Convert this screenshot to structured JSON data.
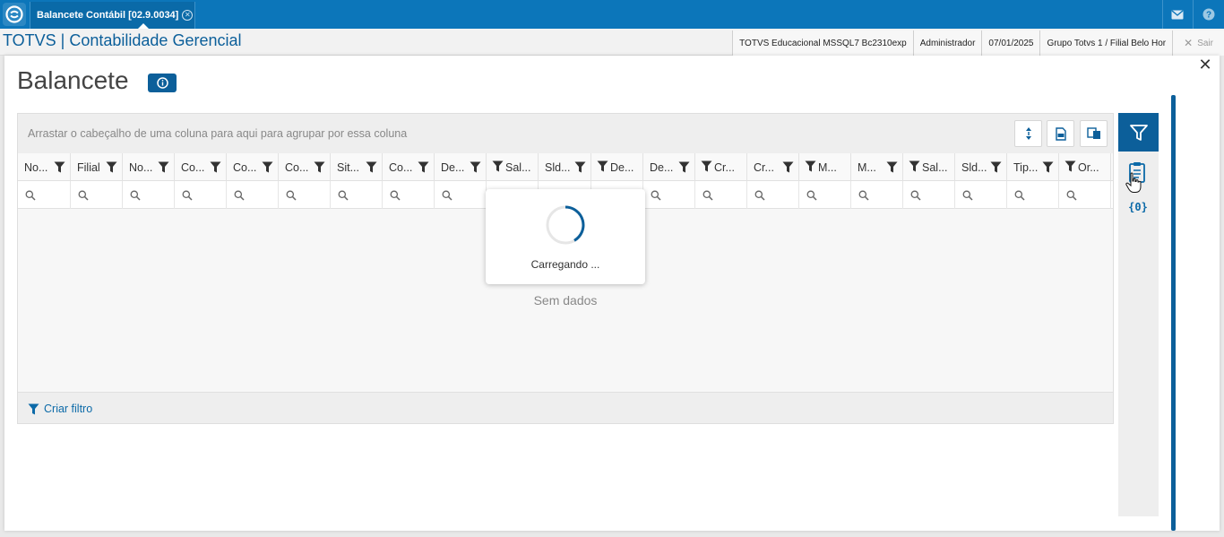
{
  "topbar": {
    "tab_label": "Balancete Contábil [02.9.0034]",
    "tab_close": "✕"
  },
  "subbar": {
    "brand": "TOTVS | Contabilidade Gerencial",
    "database": "TOTVS Educacional MSSQL7 Bc2310exp",
    "user": "Administrador",
    "date": "07/01/2025",
    "company": "Grupo Totvs 1 / Filial Belo Hor",
    "exit_label": "Sair"
  },
  "page": {
    "title": "Balancete",
    "close": "✕"
  },
  "grid": {
    "group_hint": "Arrastar o cabeçalho de uma coluna para aqui para agrupar por essa coluna",
    "columns": [
      "No...",
      "Filial",
      "No...",
      "Co...",
      "Co...",
      "Co...",
      "Sit...",
      "Co...",
      "De...",
      "Sal...",
      "Sld...",
      "De...",
      "De...",
      "Cr...",
      "Cr...",
      "M...",
      "M...",
      "Sal...",
      "Sld...",
      "Tip...",
      "Or..."
    ],
    "empty_text": "Sem dados",
    "create_filter": "Criar filtro"
  },
  "loading": {
    "text": "Carregando ..."
  },
  "side": {
    "variables_label": "{0}"
  },
  "colors": {
    "topbar": "#0c76ba",
    "accent": "#0c5f9a",
    "link": "#0c6aa8"
  }
}
